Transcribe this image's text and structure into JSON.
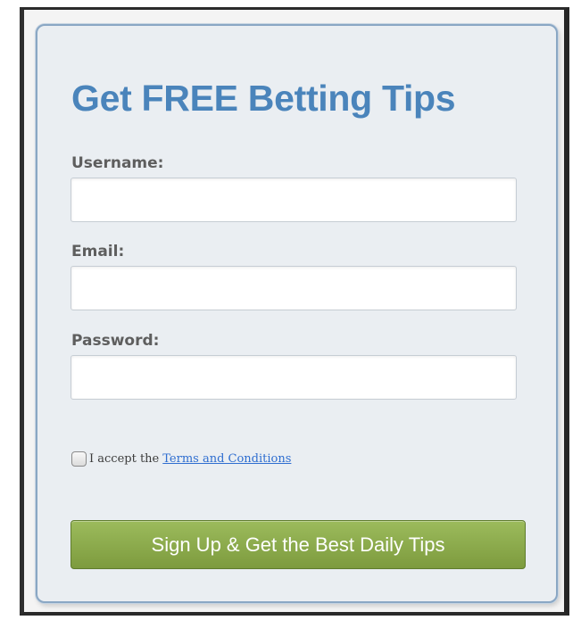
{
  "form": {
    "title": "Get FREE Betting Tips",
    "username_label": "Username:",
    "username_value": "",
    "email_label": "Email:",
    "email_value": "",
    "password_label": "Password:",
    "password_value": "",
    "terms_prefix": "I accept the",
    "terms_link": "Terms and Conditions",
    "terms_checked": false,
    "submit_label": "Sign Up & Get the Best Daily Tips"
  },
  "colors": {
    "title": "#4a84bb",
    "card_background": "#eaeef2",
    "card_border": "#8aa7c4",
    "button_green": "#8aab4c",
    "link": "#2f6ed0"
  }
}
